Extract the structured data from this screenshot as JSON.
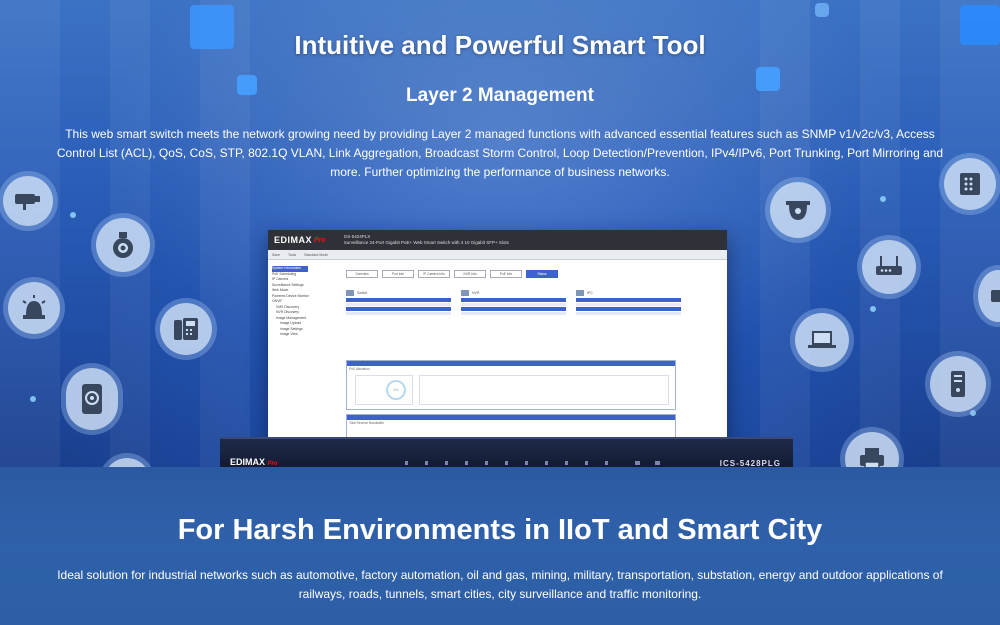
{
  "hero": {
    "title": "Intuitive and Powerful Smart Tool",
    "subtitle": "Layer 2 Management",
    "description": "This web smart switch meets the network growing need by providing Layer 2 managed functions with advanced essential features such as SNMP v1/v2c/v3, Access Control List (ACL), QoS, CoS, STP, 802.1Q VLAN, Link Aggregation, Broadcast Storm Control, Loop Detection/Prevention, IPv4/IPv6, Port Trunking, Port Mirroring and more. Further optimizing the performance of business networks."
  },
  "mockup": {
    "logo": "EDIMAX",
    "logo_suffix": "Pro",
    "model": "GS-5424PLX",
    "model_desc": "Surveillance 24-Port Gigabit PoE+ Web Smart Switch with 4 10 Gigabit SFP+ Slots",
    "toolbar": [
      "Save",
      "Tools",
      "Standard Mode"
    ],
    "tabs": [
      "Overview",
      "Port Info",
      "IP Camera Info",
      "NVR Info",
      "PoE Info",
      "Status"
    ],
    "active_tab": "Status",
    "sidebar": [
      "System Information",
      "PoE Scheduling",
      "IP Camera",
      "Surveillance Settings",
      "Web Mode",
      "Powered Device Monitor",
      "ONVIF",
      "VMS Discovery",
      "NVR Discovery",
      "Image Management",
      "Image Upload",
      "Image Settings",
      "Image View"
    ],
    "panels": [
      "Switch",
      "NVR",
      "IPC"
    ],
    "sections": [
      "PoE Allocation",
      "Total Receive Bandwidth"
    ],
    "gauge_value": "0%"
  },
  "hardware": {
    "logo": "EDIMAX",
    "logo_suffix": "Pro",
    "model": "ICS-5428PLG"
  },
  "lower": {
    "title": "For Harsh Environments in IIoT and Smart City",
    "description": "Ideal solution for industrial networks such as automotive, factory automation, oil and gas, mining, military, transportation, substation, energy and outdoor applications of railways, roads, tunnels, smart cities, city surveillance and traffic monitoring."
  },
  "icons": {
    "left": [
      "bullet-camera-icon",
      "dome-camera-icon",
      "siren-icon",
      "phone-icon",
      "touch-kiosk-icon"
    ],
    "right": [
      "server-icon",
      "ceiling-camera-icon",
      "router-icon",
      "laptop-icon",
      "server-tower-icon",
      "printer-icon"
    ]
  },
  "colors": {
    "accent": "#3d62c9",
    "background": "#2c5aa2"
  }
}
